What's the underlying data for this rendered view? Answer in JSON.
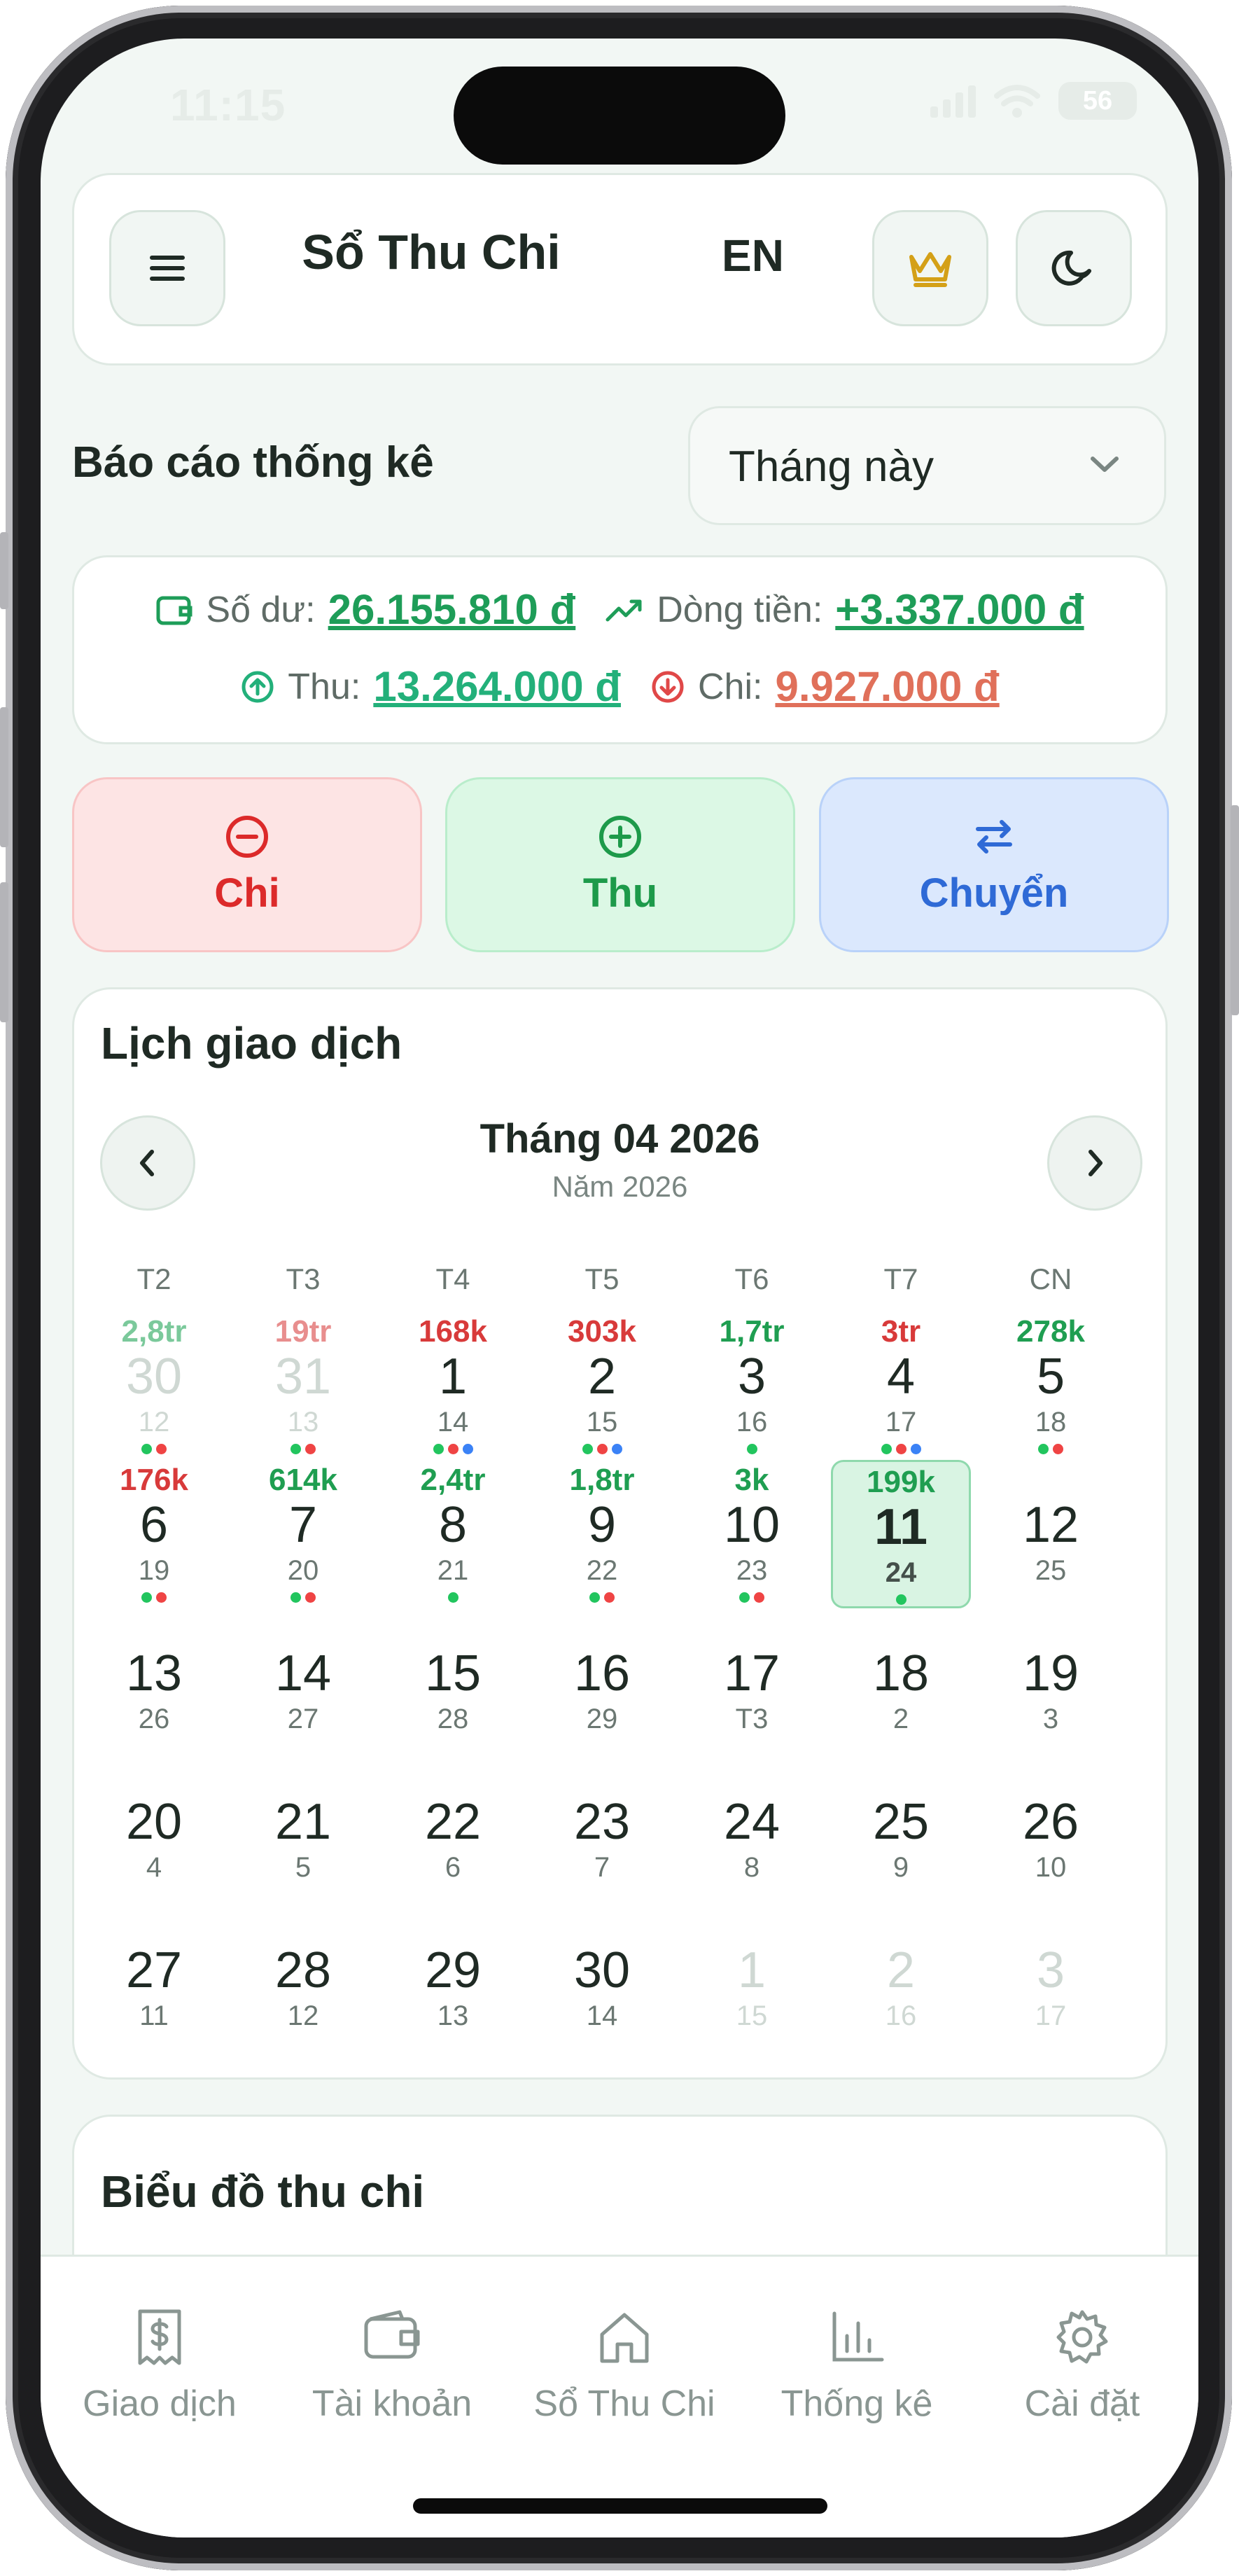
{
  "status_bar": {
    "time": "11:15",
    "battery": "56"
  },
  "header": {
    "title": "Sổ Thu Chi",
    "language": "EN"
  },
  "report": {
    "title": "Báo cáo thống kê",
    "period": "Tháng này"
  },
  "summary": {
    "balance_label": "Số dư:",
    "balance_value": "26.155.810 đ",
    "cashflow_label": "Dòng tiền:",
    "cashflow_value": "+3.337.000 đ",
    "income_label": "Thu:",
    "income_value": "13.264.000 đ",
    "expense_label": "Chi:",
    "expense_value": "9.927.000 đ"
  },
  "actions": {
    "expense": "Chi",
    "income": "Thu",
    "transfer": "Chuyển"
  },
  "calendar": {
    "title": "Lịch giao dịch",
    "month_label": "Tháng 04 2026",
    "year_label": "Năm 2026",
    "weekdays": [
      "T2",
      "T3",
      "T4",
      "T5",
      "T6",
      "T7",
      "CN"
    ],
    "weeks": [
      [
        {
          "day": "30",
          "lunar": "12",
          "amount": "2,8tr",
          "amount_type": "income",
          "dots": [
            "#22c55e",
            "#ef4444"
          ],
          "outside": true
        },
        {
          "day": "31",
          "lunar": "13",
          "amount": "19tr",
          "amount_type": "expense",
          "dots": [
            "#22c55e",
            "#ef4444"
          ],
          "outside": true
        },
        {
          "day": "1",
          "lunar": "14",
          "amount": "168k",
          "amount_type": "expense",
          "dots": [
            "#22c55e",
            "#ef4444",
            "#3b82f6"
          ]
        },
        {
          "day": "2",
          "lunar": "15",
          "amount": "303k",
          "amount_type": "expense",
          "dots": [
            "#22c55e",
            "#ef4444",
            "#3b82f6"
          ]
        },
        {
          "day": "3",
          "lunar": "16",
          "amount": "1,7tr",
          "amount_type": "income",
          "dots": [
            "#22c55e"
          ]
        },
        {
          "day": "4",
          "lunar": "17",
          "amount": "3tr",
          "amount_type": "expense",
          "dots": [
            "#22c55e",
            "#ef4444",
            "#3b82f6"
          ]
        },
        {
          "day": "5",
          "lunar": "18",
          "amount": "278k",
          "amount_type": "income",
          "dots": [
            "#22c55e",
            "#ef4444"
          ]
        }
      ],
      [
        {
          "day": "6",
          "lunar": "19",
          "amount": "176k",
          "amount_type": "expense",
          "dots": [
            "#22c55e",
            "#ef4444"
          ]
        },
        {
          "day": "7",
          "lunar": "20",
          "amount": "614k",
          "amount_type": "income",
          "dots": [
            "#22c55e",
            "#ef4444"
          ]
        },
        {
          "day": "8",
          "lunar": "21",
          "amount": "2,4tr",
          "amount_type": "income",
          "dots": [
            "#22c55e"
          ]
        },
        {
          "day": "9",
          "lunar": "22",
          "amount": "1,8tr",
          "amount_type": "income",
          "dots": [
            "#22c55e",
            "#ef4444"
          ]
        },
        {
          "day": "10",
          "lunar": "23",
          "amount": "3k",
          "amount_type": "income",
          "dots": [
            "#22c55e",
            "#ef4444"
          ]
        },
        {
          "day": "11",
          "lunar": "24",
          "amount": "199k",
          "amount_type": "income",
          "dots": [
            "#22c55e"
          ],
          "today": true
        },
        {
          "day": "12",
          "lunar": "25",
          "amount": "",
          "dots": []
        }
      ],
      [
        {
          "day": "13",
          "lunar": "26",
          "amount": "",
          "dots": []
        },
        {
          "day": "14",
          "lunar": "27",
          "amount": "",
          "dots": []
        },
        {
          "day": "15",
          "lunar": "28",
          "amount": "",
          "dots": []
        },
        {
          "day": "16",
          "lunar": "29",
          "amount": "",
          "dots": []
        },
        {
          "day": "17",
          "lunar": "T3",
          "amount": "",
          "dots": []
        },
        {
          "day": "18",
          "lunar": "2",
          "amount": "",
          "dots": []
        },
        {
          "day": "19",
          "lunar": "3",
          "amount": "",
          "dots": []
        }
      ],
      [
        {
          "day": "20",
          "lunar": "4",
          "amount": "",
          "dots": []
        },
        {
          "day": "21",
          "lunar": "5",
          "amount": "",
          "dots": []
        },
        {
          "day": "22",
          "lunar": "6",
          "amount": "",
          "dots": []
        },
        {
          "day": "23",
          "lunar": "7",
          "amount": "",
          "dots": []
        },
        {
          "day": "24",
          "lunar": "8",
          "amount": "",
          "dots": []
        },
        {
          "day": "25",
          "lunar": "9",
          "amount": "",
          "dots": []
        },
        {
          "day": "26",
          "lunar": "10",
          "amount": "",
          "dots": []
        }
      ],
      [
        {
          "day": "27",
          "lunar": "11",
          "amount": "",
          "dots": []
        },
        {
          "day": "28",
          "lunar": "12",
          "amount": "",
          "dots": []
        },
        {
          "day": "29",
          "lunar": "13",
          "amount": "",
          "dots": []
        },
        {
          "day": "30",
          "lunar": "14",
          "amount": "",
          "dots": []
        },
        {
          "day": "1",
          "lunar": "15",
          "amount": "",
          "dots": [],
          "outside": true
        },
        {
          "day": "2",
          "lunar": "16",
          "amount": "",
          "dots": [],
          "outside": true
        },
        {
          "day": "3",
          "lunar": "17",
          "amount": "",
          "dots": [],
          "outside": true
        }
      ]
    ]
  },
  "chart_section": {
    "title": "Biểu đồ thu chi"
  },
  "bottom_nav": [
    {
      "label": "Giao dịch",
      "icon": "receipt-dollar-icon"
    },
    {
      "label": "Tài khoản",
      "icon": "wallet-icon"
    },
    {
      "label": "Sổ Thu Chi",
      "icon": "home-icon"
    },
    {
      "label": "Thống kê",
      "icon": "bar-chart-icon"
    },
    {
      "label": "Cài đặt",
      "icon": "gear-icon"
    }
  ],
  "colors": {
    "income": "#1e9d58",
    "expense": "#e0705a",
    "transfer": "#2f6ad6",
    "crown": "#d4a017",
    "background": "#f2f7f4"
  }
}
